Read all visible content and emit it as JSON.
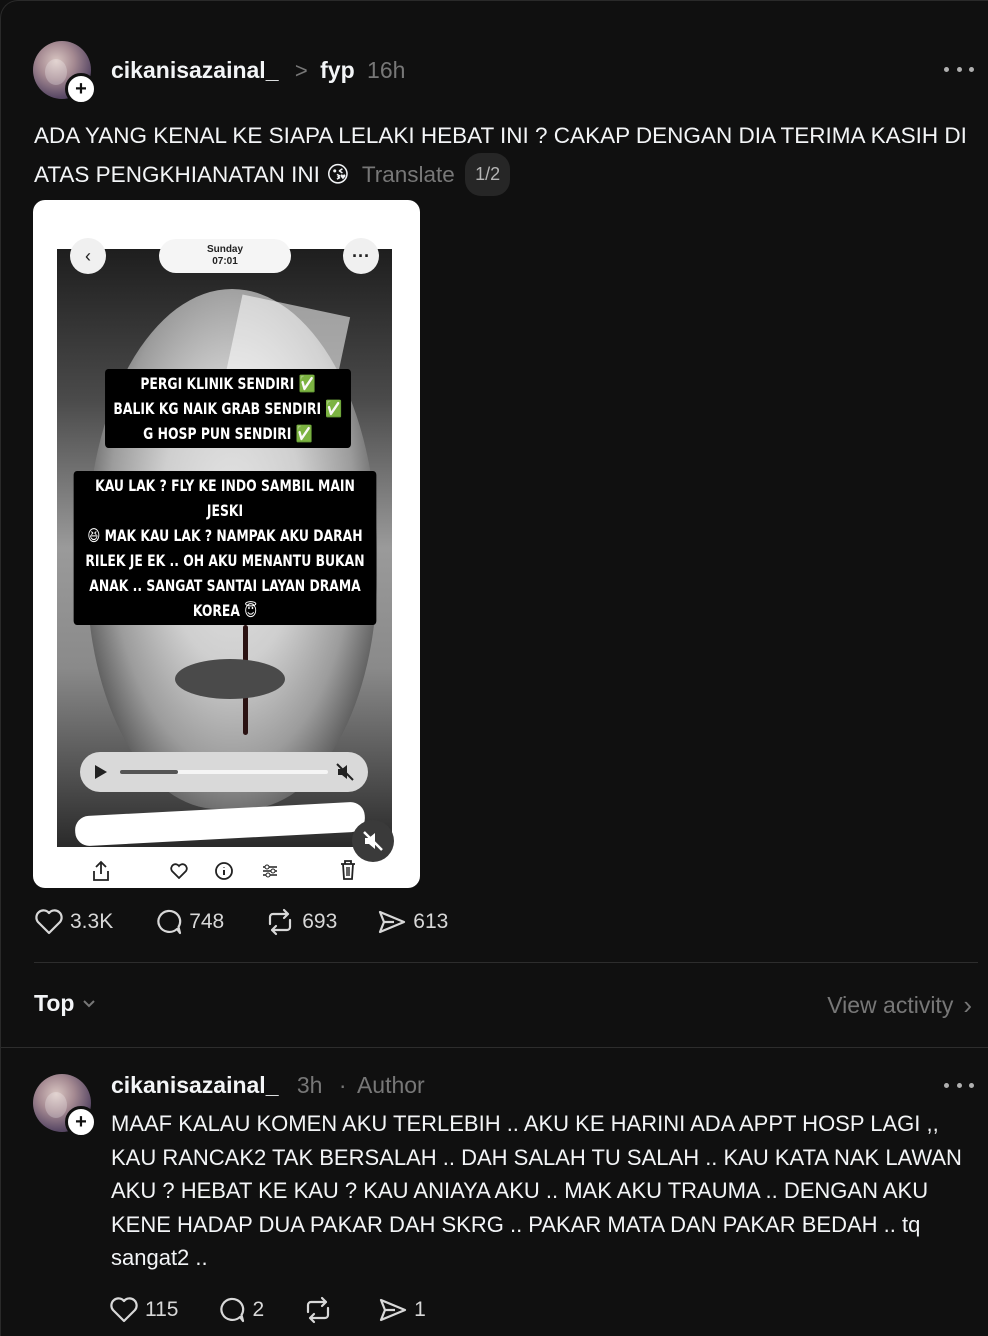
{
  "post": {
    "username": "cikanisazainal_",
    "separator": ">",
    "topic": "fyp",
    "time": "16h",
    "text": "ADA YANG KENAL KE SIAPA LELAKI HEBAT INI ? CAKAP DENGAN DIA TERIMA KASIH DI ATAS PENGKHIANATAN INI 😘",
    "translate_label": "Translate",
    "pager": "1/2",
    "media": {
      "top_day": "Sunday",
      "top_time": "07:01",
      "caption1": [
        "PERGI KLINIK SENDIRI ✅",
        "BALIK KG NAIK GRAB SENDIRI ✅",
        "G HOSP PUN SENDIRI ✅"
      ],
      "caption2": [
        "KAU LAK ? FLY KE INDO SAMBIL MAIN JESKI",
        "😆 MAK KAU LAK ? NAMPAK AKU DARAH",
        "RILEK JE EK .. OH AKU MENANTU BUKAN",
        "ANAK .. SANGAT SANTAI LAYAN DRAMA",
        "KOREA 😇"
      ]
    },
    "stats": {
      "likes": "3.3K",
      "comments": "748",
      "reposts": "693",
      "shares": "613"
    }
  },
  "filter": {
    "sort_label": "Top",
    "view_activity": "View activity"
  },
  "comment": {
    "username": "cikanisazainal_",
    "time": "3h",
    "dot": "·",
    "badge": "Author",
    "text": "MAAF KALAU KOMEN AKU TERLEBIH .. AKU KE HARINI ADA APPT HOSP LAGI ,, KAU RANCAK2 TAK BERSALAH .. DAH SALAH TU SALAH .. KAU KATA NAK LAWAN AKU ? HEBAT KE KAU ? KAU ANIAYA AKU .. MAK AKU TRAUMA .. DENGAN AKU KENE HADAP DUA PAKAR DAH SKRG .. PAKAR MATA DAN PAKAR BEDAH .. tq sangat2 ..",
    "stats": {
      "likes": "115",
      "comments": "2",
      "shares": "1"
    }
  },
  "icons": {
    "plus": "+",
    "more": "more-icon",
    "chevron": "›"
  }
}
